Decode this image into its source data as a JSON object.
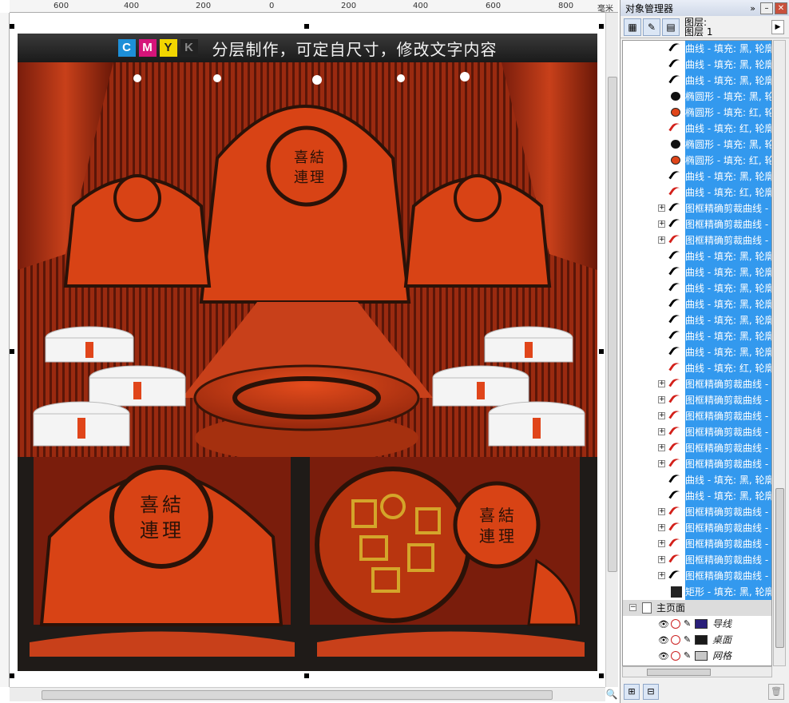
{
  "ruler": {
    "top_labels": [
      "600",
      "400",
      "200",
      "0",
      "200",
      "400",
      "600",
      "800"
    ],
    "unit": "毫米"
  },
  "artwork": {
    "banner_letters": [
      {
        "letter": "C",
        "color": "#1d8fd8"
      },
      {
        "letter": "M",
        "color": "#d6147a"
      },
      {
        "letter": "Y",
        "color": "#f2d500"
      },
      {
        "letter": "K",
        "color": "#222222"
      }
    ],
    "banner_text": "分层制作，可定自尺寸，修改文字内容",
    "emblem_chars": [
      "喜",
      "結",
      "連",
      "理"
    ],
    "lower_left_chars": [
      "喜",
      "結",
      "連",
      "理"
    ],
    "lower_right_chars": [
      "喜",
      "結",
      "連",
      "理"
    ]
  },
  "docker": {
    "title": "对象管理器",
    "layer_line1": "图层:",
    "layer_line2": "图层 1",
    "objects": [
      {
        "expand": false,
        "icon": "curve-black",
        "label": "曲线 - 填充: 黑, 轮廓"
      },
      {
        "expand": false,
        "icon": "curve-black",
        "label": "曲线 - 填充: 黑, 轮廓"
      },
      {
        "expand": false,
        "icon": "curve-black",
        "label": "曲线 - 填充: 黑, 轮廓"
      },
      {
        "expand": false,
        "icon": "ellipse-black",
        "label": "椭圆形 - 填充: 黑, 轮"
      },
      {
        "expand": false,
        "icon": "ellipse-red",
        "label": "椭圆形 - 填充: 红, 轮"
      },
      {
        "expand": false,
        "icon": "curve-red",
        "label": "曲线 - 填充: 红, 轮廓"
      },
      {
        "expand": false,
        "icon": "ellipse-black",
        "label": "椭圆形 - 填充: 黑, 轮"
      },
      {
        "expand": false,
        "icon": "ellipse-red",
        "label": "椭圆形 - 填充: 红, 轮"
      },
      {
        "expand": false,
        "icon": "curve-black",
        "label": "曲线 - 填充: 黑, 轮廓"
      },
      {
        "expand": false,
        "icon": "curve-red",
        "label": "曲线 - 填充: 红, 轮廓"
      },
      {
        "expand": true,
        "icon": "curve-black",
        "label": "图框精确剪裁曲线 -"
      },
      {
        "expand": true,
        "icon": "curve-black",
        "label": "图框精确剪裁曲线 -"
      },
      {
        "expand": true,
        "icon": "curve-red",
        "label": "图框精确剪裁曲线 -"
      },
      {
        "expand": false,
        "icon": "curve-black",
        "label": "曲线 - 填充: 黑, 轮廓"
      },
      {
        "expand": false,
        "icon": "curve-black",
        "label": "曲线 - 填充: 黑, 轮廓"
      },
      {
        "expand": false,
        "icon": "curve-black",
        "label": "曲线 - 填充: 黑, 轮廓"
      },
      {
        "expand": false,
        "icon": "curve-black",
        "label": "曲线 - 填充: 黑, 轮廓"
      },
      {
        "expand": false,
        "icon": "curve-black",
        "label": "曲线 - 填充: 黑, 轮廓"
      },
      {
        "expand": false,
        "icon": "curve-black",
        "label": "曲线 - 填充: 黑, 轮廓"
      },
      {
        "expand": false,
        "icon": "curve-black",
        "label": "曲线 - 填充: 黑, 轮廓"
      },
      {
        "expand": false,
        "icon": "curve-red",
        "label": "曲线 - 填充: 红, 轮廓"
      },
      {
        "expand": true,
        "icon": "curve-red",
        "label": "图框精确剪裁曲线 -"
      },
      {
        "expand": true,
        "icon": "curve-red",
        "label": "图框精确剪裁曲线 -"
      },
      {
        "expand": true,
        "icon": "curve-red",
        "label": "图框精确剪裁曲线 -"
      },
      {
        "expand": true,
        "icon": "curve-red",
        "label": "图框精确剪裁曲线 -"
      },
      {
        "expand": true,
        "icon": "curve-red",
        "label": "图框精确剪裁曲线 -"
      },
      {
        "expand": true,
        "icon": "curve-red",
        "label": "图框精确剪裁曲线 -"
      },
      {
        "expand": false,
        "icon": "curve-black",
        "label": "曲线 - 填充: 黑, 轮廓"
      },
      {
        "expand": false,
        "icon": "curve-black",
        "label": "曲线 - 填充: 黑, 轮廓"
      },
      {
        "expand": true,
        "icon": "curve-red",
        "label": "图框精确剪裁曲线 -"
      },
      {
        "expand": true,
        "icon": "curve-red",
        "label": "图框精确剪裁曲线 -"
      },
      {
        "expand": true,
        "icon": "curve-red",
        "label": "图框精确剪裁曲线 -"
      },
      {
        "expand": true,
        "icon": "curve-red",
        "label": "图框精确剪裁曲线 -"
      },
      {
        "expand": true,
        "icon": "curve-black",
        "label": "图框精确剪裁曲线 -"
      },
      {
        "expand": false,
        "icon": "rect-black",
        "label": "矩形 - 填充: 黑, 轮廓"
      }
    ],
    "master_page": {
      "label": "主页面",
      "layers": [
        {
          "label": "导线",
          "swatch": "#2a1f7a"
        },
        {
          "label": "桌面",
          "swatch": "#1a1a1a"
        },
        {
          "label": "网格",
          "swatch": "#c8c8c8"
        }
      ]
    }
  },
  "colors": {
    "selection": "#3399ee",
    "stage_red": "#d84315",
    "dark": "#1f1b18"
  }
}
